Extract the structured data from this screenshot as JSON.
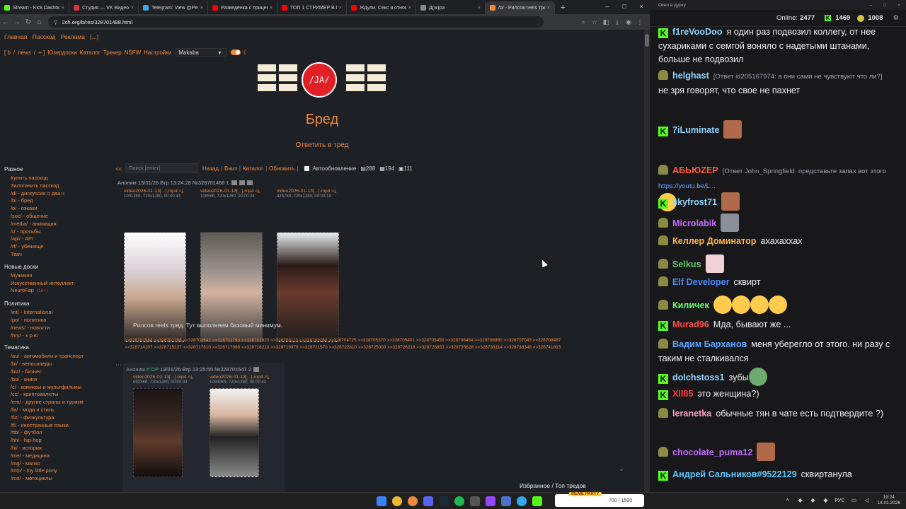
{
  "browser": {
    "tabs": [
      {
        "title": "Stream - Kick Dashboard",
        "color": "#53fc18"
      },
      {
        "title": "Студия — VK Видео Li",
        "color": "#e0323e"
      },
      {
        "title": "Telegram: View @Petyo",
        "color": "#3aa6e4"
      },
      {
        "title": "Разведёнка с прицеп",
        "color": "#ff0000"
      },
      {
        "title": "ТОП 1 СТРИМЕР В МИ",
        "color": "#ff0000"
      },
      {
        "title": "Ждули. Секс и отноше",
        "color": "#ff0000"
      },
      {
        "title": "Д(w)ра",
        "color": "#888888"
      },
      {
        "title": "/b/ - Рилсов reels тред",
        "color": "#f0883e"
      }
    ],
    "url": "2ch.org/b/res/328701488.html"
  },
  "site": {
    "top_links": [
      "Главная",
      "Пасскод",
      "Реклама",
      "[...]"
    ],
    "board_line": [
      "[ b",
      "/",
      "news",
      "/",
      "+ ]",
      "Юзердоски",
      "Каталог",
      "Трекер",
      "NSFW",
      "Настройки"
    ],
    "style_select": "Makaba",
    "logo_text": "/JA/",
    "board_title": "Бред",
    "reply_link": "Ответить в тред",
    "sidebar": [
      {
        "heading": "Разное",
        "items": [
          "Купить пасскод",
          "Залогинить пасскод",
          "/d/ - дискуссии о два.ч",
          "/b/ - бред",
          "/o/ - оэкаки",
          "/soc/ - общение",
          "/media/ - анимация",
          "/r/ - просьбы",
          "/api/ - API",
          "/rf/ - убежище",
          "Твач"
        ]
      },
      {
        "heading": "Новые доски",
        "items": [
          "Мужикач",
          "Искусственный интеллект",
          "NeuroFap"
        ]
      },
      {
        "heading": "Политика",
        "items": [
          "/int/ - International",
          "/po/ - политика",
          "/news/ - новости",
          "/hry/ - х р ю"
        ]
      },
      {
        "heading": "Тематика",
        "items": [
          "/au/ - автомобили и транспорт",
          "/bi/ - велосипеды",
          "/biz/ - бизнес",
          "/bo/ - книги",
          "/c/ - комиксы и мультфильмы",
          "/cc/ - криптовалюты",
          "/em/ - другие страны и туризм",
          "/fa/ - мода и стиль",
          "/fiz/ - физкультура",
          "/fl/ - иностранные языки",
          "/ftb/ - футбол",
          "/hh/ - hip-hop",
          "/hi/ - история",
          "/me/ - медицина",
          "/mg/ - магия",
          "/mlp/ - my little pony",
          "/mo/ - мотоциклы"
        ]
      }
    ],
    "new_badge": "(18+)",
    "search_placeholder": "Поиск [enter]",
    "thread_nav": [
      "Назад",
      "Вниз",
      "Каталог",
      "Обновить"
    ],
    "autoupdate_label": "Автообновление",
    "stats": {
      "posts": "288",
      "files": "194",
      "images": "111"
    },
    "op": {
      "header": "Аноним  13/01/26 Втр 13:24:28 №328701488  1",
      "files": [
        {
          "name": "video2026-01-13[...].mp4",
          "meta": "10012Кб, 720x1280, 00:00:43"
        },
        {
          "name": "video2026-01-13[...].mp4",
          "meta": "10858б, 720x1280, 00:00:24"
        },
        {
          "name": "video2026-01-13[...].mp4",
          "meta": "4257Кб, 720x1280, 00:00:19"
        }
      ],
      "text": "Рилсов reels тред. Тут выполняем базовый минимум.",
      "replies": ">>328701588 >>328701798 >>328702642 >>328702793 >>328702823 >>328703113 >>328703260 >>328704725 >>328705370 >>328705401 >>328705458 >>328706494 >>328706980 >>328707043 >>328708487 >>328714107 >>328715237 >>328717810 >>328717968 >>328718210 >>328719979 >>328721570 >>328722810 >>328725000 >>328726218 >>328726853 >>328735628 >>328738114 >>328738348 >>328741863"
    },
    "reply": {
      "author": "Аноним",
      "badge": "# OP",
      "date": "13/01/26 Втр 13:25:55 №328701547  2",
      "files": [
        {
          "name": "video2026-01-13[...].mp4",
          "meta": "6923Кб, 720x1280, 00:00:33"
        },
        {
          "name": "video2026-01-13[...].mp4",
          "meta": "10940Кб, 720x1280, 00:00:43"
        }
      ]
    },
    "bottom_links": "Избранное / Топ тредов"
  },
  "chat": {
    "window_title": "Окно в дурку",
    "online_label": "Online:",
    "online": "2477",
    "kick_count": "1469",
    "coin_count": "1008",
    "messages": [
      {
        "badge": "k",
        "user": "f1reVooDoo",
        "color": "#8fd4ff",
        "text": "я один раз подвозил коллегу, от нее сухариками с семгой воняло с надетыми штанами, больше не подвозил"
      },
      {
        "badge": "p",
        "user": "helghast",
        "color": "#8fd4ff",
        "ref": "[Ответ id205167974: а они сами не чувствуют что ли?]",
        "text": "не зря говорят, что свое не пахнет"
      },
      {
        "badge": "k",
        "user": "7iLuminate",
        "color": "#8fd4ff",
        "text": ""
      },
      {
        "badge": "p",
        "user": "АБЬЮZЕР",
        "color": "#ff5a36",
        "ref": "[Ответ John_Springfield: представьте запах вот этого",
        "link": "https://youtu.be/L...",
        "text": ""
      },
      {
        "badge": "k",
        "user": "skyfrost71",
        "color": "#8fd4ff",
        "text": ""
      },
      {
        "badge": "p",
        "user": "Microlabik",
        "color": "#c56bff",
        "text": ""
      },
      {
        "badge": "p",
        "user": "Келлер Доминатор",
        "color": "#ffb34d",
        "text": "ахахаххах"
      },
      {
        "badge": "p",
        "user": "Selkus",
        "color": "#6bc46b",
        "text": ""
      },
      {
        "badge": "p",
        "user": "Elf Developer",
        "color": "#4a8cff",
        "text": "сквирт"
      },
      {
        "badge": "p",
        "user": "Киличек",
        "color": "#6bff6b",
        "text": ""
      },
      {
        "badge": "k",
        "user": "Murad96",
        "color": "#ff4d4d",
        "text": "Мда, бывают же ..."
      },
      {
        "badge": "p",
        "user": "Вадим Барханов",
        "color": "#5aa8ff",
        "text": "меня уберегло от этого. ни разу с таким не сталкивался"
      },
      {
        "badge": "k",
        "user": "dolchstoss1",
        "color": "#8fd4ff",
        "text": "зубы"
      },
      {
        "badge": "k",
        "user": "XII85",
        "color": "#ff3b3b",
        "text": "это женщина?)"
      },
      {
        "badge": "p",
        "user": "leranetka",
        "color": "#ff9fc0",
        "text": "обычные тян в чате есть подтвердите ?)"
      },
      {
        "badge": "p",
        "user": "chocolate_puma12",
        "color": "#c56bff",
        "text": ""
      },
      {
        "badge": "k",
        "user": "Андрей Сальников#9522129",
        "color": "#5ec8ff",
        "text": "сквиртанула"
      }
    ]
  },
  "taskbar": {
    "app_label": "MEME PARTY",
    "app_progress": "700 / 1500",
    "lang": "РУС",
    "time": "19:24",
    "date": "14.01.2026"
  }
}
